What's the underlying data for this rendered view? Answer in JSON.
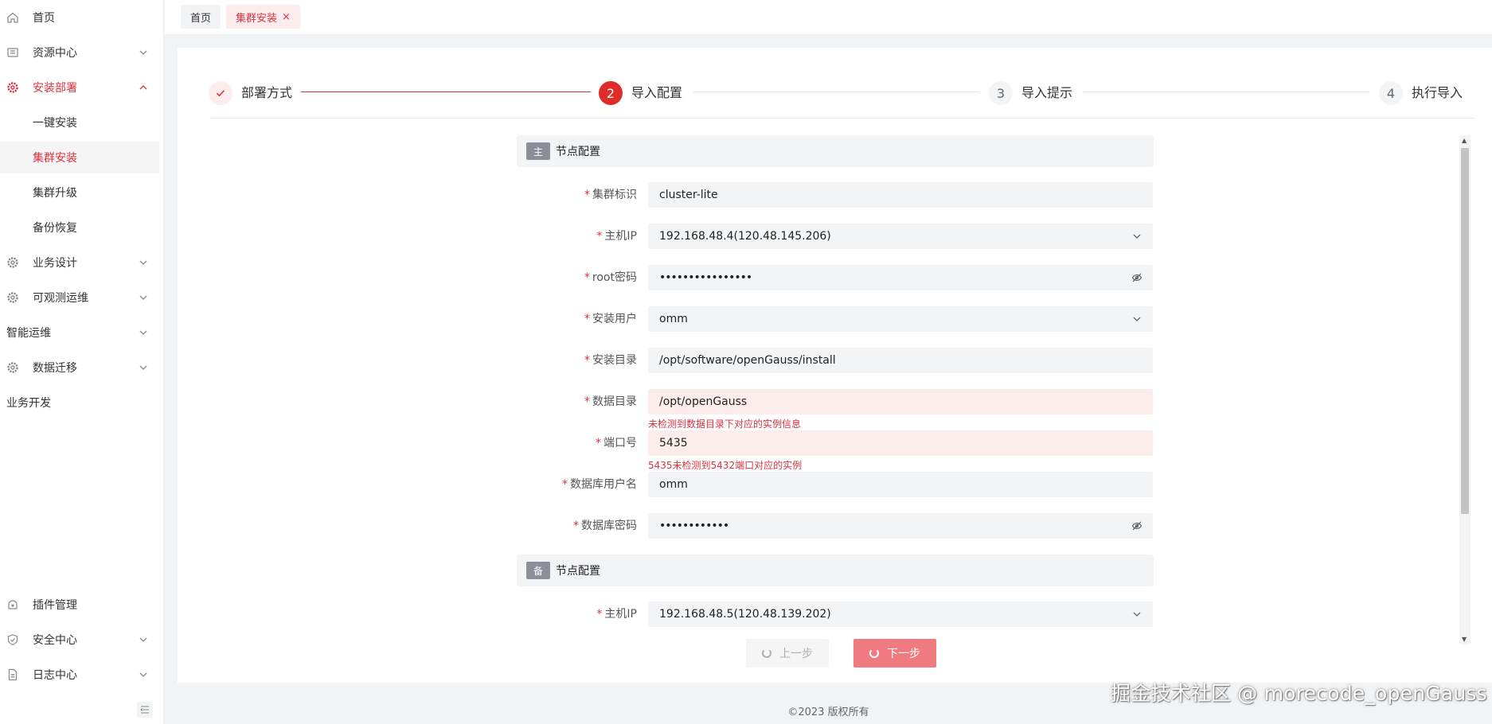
{
  "sidebar": {
    "items": [
      {
        "label": "首页",
        "icon": "home-icon"
      },
      {
        "label": "资源中心",
        "icon": "resource-icon"
      },
      {
        "label": "安装部署",
        "icon": "gear-icon"
      },
      {
        "label": "一键安装"
      },
      {
        "label": "集群安装"
      },
      {
        "label": "集群升级"
      },
      {
        "label": "备份恢复"
      },
      {
        "label": "业务设计",
        "icon": "gear-icon"
      },
      {
        "label": "可观测运维",
        "icon": "gear-icon"
      },
      {
        "label": "智能运维"
      },
      {
        "label": "数据迁移",
        "icon": "gear-icon"
      },
      {
        "label": "业务开发"
      },
      {
        "label": "插件管理",
        "icon": "plugin-icon"
      },
      {
        "label": "安全中心",
        "icon": "shield-icon"
      },
      {
        "label": "日志中心",
        "icon": "log-icon"
      }
    ]
  },
  "tabs": [
    {
      "label": "首页"
    },
    {
      "label": "集群安装",
      "close": "×"
    }
  ],
  "steps": [
    {
      "num": "",
      "label": "部署方式",
      "state": "done"
    },
    {
      "num": "2",
      "label": "导入配置",
      "state": "active"
    },
    {
      "num": "3",
      "label": "导入提示",
      "state": "pending"
    },
    {
      "num": "4",
      "label": "执行导入",
      "state": "pending"
    }
  ],
  "sections": {
    "master": {
      "badge": "主",
      "title": "节点配置"
    },
    "standby": {
      "badge": "备",
      "title": "节点配置"
    }
  },
  "form": {
    "cluster_id": {
      "label": "集群标识",
      "value": "cluster-lite"
    },
    "host_ip": {
      "label": "主机IP",
      "value": "192.168.48.4(120.48.145.206)"
    },
    "root_pwd": {
      "label": "root密码",
      "value": "••••••••••••••••"
    },
    "install_user": {
      "label": "安装用户",
      "value": "omm"
    },
    "install_dir": {
      "label": "安装目录",
      "value": "/opt/software/openGauss/install"
    },
    "data_dir": {
      "label": "数据目录",
      "value": "/opt/openGauss",
      "error": "未检测到数据目录下对应的实例信息"
    },
    "port": {
      "label": "端口号",
      "value": "5435",
      "error": "5435未检测到5432端口对应的实例"
    },
    "db_user": {
      "label": "数据库用户名",
      "value": "omm"
    },
    "db_pwd": {
      "label": "数据库密码",
      "value": "••••••••••••"
    },
    "standby_host_ip": {
      "label": "主机IP",
      "value": "192.168.48.5(120.48.139.202)"
    }
  },
  "buttons": {
    "prev": "上一步",
    "next": "下一步"
  },
  "footer": "©2023 版权所有",
  "watermark": "掘金技术社区 @ morecode_openGauss",
  "colors": {
    "accent": "#d7333e",
    "next_button": "#ef7b80",
    "error_bg": "#fdecec"
  }
}
